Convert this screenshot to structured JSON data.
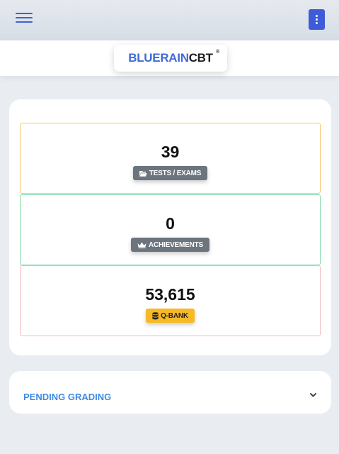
{
  "header": {
    "menu_icon": "hamburger-icon",
    "options_icon": "kebab-vertical-icon",
    "accent_color": "#3e5bd9"
  },
  "brand": {
    "part1": "BLUERAIN",
    "part2": "CBT",
    "mark": "®",
    "part1_color": "#3f6ad8"
  },
  "stats": [
    {
      "value": "39",
      "label": "TESTS / EXAMS",
      "icon": "folder-open-icon",
      "border_color": "#f7c66a"
    },
    {
      "value": "0",
      "label": "ACHIEVEMENTS",
      "icon": "crown-icon",
      "border_color": "#7fdaa8"
    },
    {
      "value": "53,615",
      "label": "Q-BANK",
      "icon": "database-icon",
      "border_color": "#f3b9c1"
    }
  ],
  "pending": {
    "title": "PENDING GRADING",
    "icon": "chevron-down-icon"
  }
}
